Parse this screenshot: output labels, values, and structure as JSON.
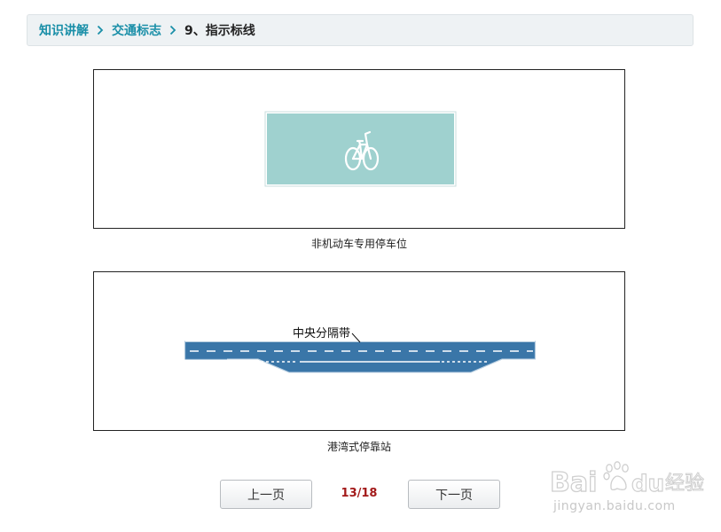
{
  "breadcrumb": {
    "items": [
      "知识讲解",
      "交通标志"
    ],
    "current": "9、指示标线",
    "separator_icon": "chevron-right-icon"
  },
  "figures": [
    {
      "caption": "非机动车专用停车位",
      "icon": "bicycle-icon",
      "panel_color": "#9fd1cf"
    },
    {
      "caption": "港湾式停靠站",
      "road_label": "中央分隔带",
      "road_color": "#3a76a8"
    }
  ],
  "pager": {
    "prev_label": "上一页",
    "next_label": "下一页",
    "indicator": "13/18",
    "indicator_color": "#a31a1a"
  },
  "watermark": {
    "brand_text": "Baidu经验",
    "sub_text": "jingyan.baidu.com"
  }
}
